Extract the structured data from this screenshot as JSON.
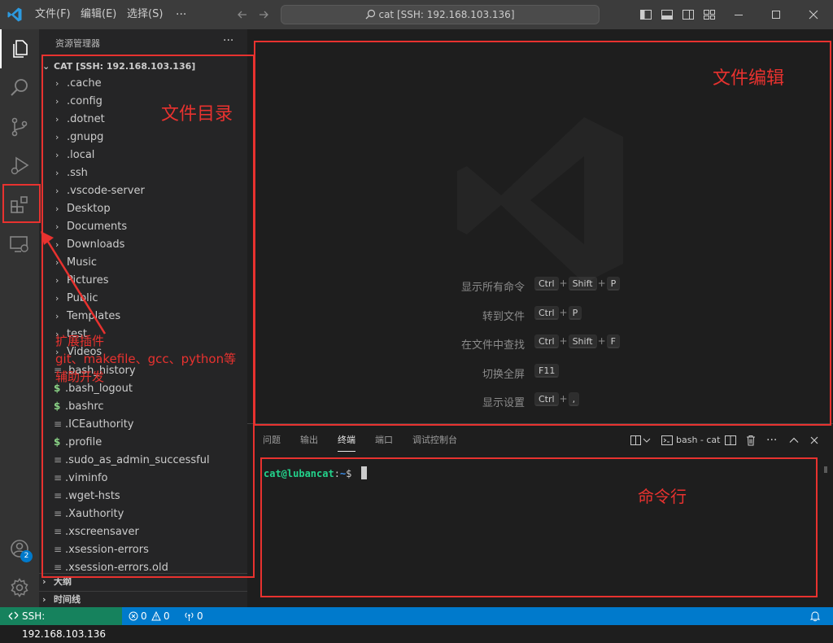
{
  "titlebar": {
    "menus": [
      "文件(F)",
      "编辑(E)",
      "选择(S)"
    ],
    "more": "···",
    "command_center": "cat [SSH: 192.168.103.136]"
  },
  "sidebar": {
    "title": "资源管理器",
    "more": "···",
    "root_label": "CAT [SSH: 192.168.103.136]",
    "folders": [
      ".cache",
      ".config",
      ".dotnet",
      ".gnupg",
      ".local",
      ".ssh",
      ".vscode-server",
      "Desktop",
      "Documents",
      "Downloads",
      "Music",
      "Pictures",
      "Public",
      "Templates",
      "test",
      "Videos"
    ],
    "files": [
      {
        "name": ".bash_history",
        "icon": "lines"
      },
      {
        "name": ".bash_logout",
        "icon": "dollar"
      },
      {
        "name": ".bashrc",
        "icon": "dollar"
      },
      {
        "name": ".ICEauthority",
        "icon": "lines"
      },
      {
        "name": ".profile",
        "icon": "dollar"
      },
      {
        "name": ".sudo_as_admin_successful",
        "icon": "lines"
      },
      {
        "name": ".viminfo",
        "icon": "lines"
      },
      {
        "name": ".wget-hsts",
        "icon": "lines"
      },
      {
        "name": ".Xauthority",
        "icon": "lines"
      },
      {
        "name": ".xscreensaver",
        "icon": "lines"
      },
      {
        "name": ".xsession-errors",
        "icon": "lines"
      },
      {
        "name": ".xsession-errors.old",
        "icon": "lines"
      }
    ],
    "outline_label": "大纲",
    "timeline_label": "时间线"
  },
  "activitybar": {
    "accounts_badge": "2"
  },
  "editor": {
    "hints": [
      {
        "label": "显示所有命令",
        "keys": [
          "Ctrl",
          "Shift",
          "P"
        ]
      },
      {
        "label": "转到文件",
        "keys": [
          "Ctrl",
          "P"
        ]
      },
      {
        "label": "在文件中查找",
        "keys": [
          "Ctrl",
          "Shift",
          "F"
        ]
      },
      {
        "label": "切换全屏",
        "keys": [
          "F11"
        ]
      },
      {
        "label": "显示设置",
        "keys": [
          "Ctrl",
          ","
        ]
      }
    ]
  },
  "panel": {
    "tabs": [
      "问题",
      "输出",
      "终端",
      "端口",
      "调试控制台"
    ],
    "active_tab": "终端",
    "terminal_name": "bash - cat",
    "prompt_user": "cat@lubancat",
    "prompt_sep": ":",
    "prompt_path": "~",
    "prompt_sign": "$"
  },
  "statusbar": {
    "remote": "SSH: 192.168.103.136",
    "errors": "0",
    "warnings": "0",
    "ports": "0"
  },
  "annotations": {
    "file_tree": "文件目录",
    "file_edit": "文件编辑",
    "terminal": "命令行",
    "extensions_line1": "扩展插件",
    "extensions_line2": "git、makefile、gcc、python等",
    "extensions_line3": "辅助开发"
  },
  "colors": {
    "accent": "#007acc",
    "annotation_red": "#e8322f",
    "prompt_green": "#23d18b",
    "prompt_blue": "#3b8eea",
    "dollar_green": "#89d185"
  }
}
